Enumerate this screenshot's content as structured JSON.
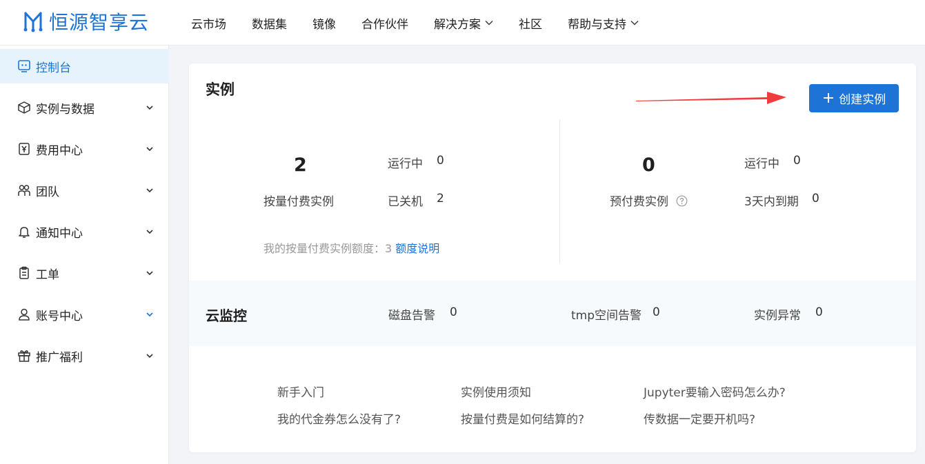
{
  "brand": {
    "name": "恒源智享云",
    "color": "#1d74d6"
  },
  "nav": [
    {
      "label": "云市场",
      "dropdown": false
    },
    {
      "label": "数据集",
      "dropdown": false
    },
    {
      "label": "镜像",
      "dropdown": false
    },
    {
      "label": "合作伙伴",
      "dropdown": false
    },
    {
      "label": "解决方案",
      "dropdown": true
    },
    {
      "label": "社区",
      "dropdown": false
    },
    {
      "label": "帮助与支持",
      "dropdown": true
    }
  ],
  "sidebar": {
    "items": [
      {
        "label": "控制台",
        "icon": "console-icon",
        "active": true
      },
      {
        "label": "实例与数据",
        "icon": "cube-icon"
      },
      {
        "label": "费用中心",
        "icon": "yen-icon"
      },
      {
        "label": "团队",
        "icon": "team-icon"
      },
      {
        "label": "通知中心",
        "icon": "bell-icon"
      },
      {
        "label": "工单",
        "icon": "clipboard-icon"
      },
      {
        "label": "账号中心",
        "icon": "user-icon"
      },
      {
        "label": "推广福利",
        "icon": "gift-icon"
      }
    ]
  },
  "instances": {
    "title": "实例",
    "create_button": "创建实例",
    "payg": {
      "count": "2",
      "label": "按量付费实例",
      "running_label": "运行中",
      "running_value": "0",
      "stopped_label": "已关机",
      "stopped_value": "2",
      "quota_text": "我的按量付费实例额度：3",
      "quota_link": "额度说明"
    },
    "prepaid": {
      "count": "0",
      "label": "预付费实例",
      "running_label": "运行中",
      "running_value": "0",
      "expiring_label": "3天内到期",
      "expiring_value": "0"
    }
  },
  "monitor": {
    "title": "云监控",
    "disk_label": "磁盘告警",
    "disk_value": "0",
    "tmp_label": "tmp空间告警",
    "tmp_value": "0",
    "abnormal_label": "实例异常",
    "abnormal_value": "0"
  },
  "faq": {
    "col1": [
      "新手入门",
      "我的代金券怎么没有了?"
    ],
    "col2": [
      "实例使用须知",
      "按量付费是如何结算的?"
    ],
    "col3": [
      "Jupyter要输入密码怎么办?",
      "传数据一定要开机吗?"
    ]
  }
}
